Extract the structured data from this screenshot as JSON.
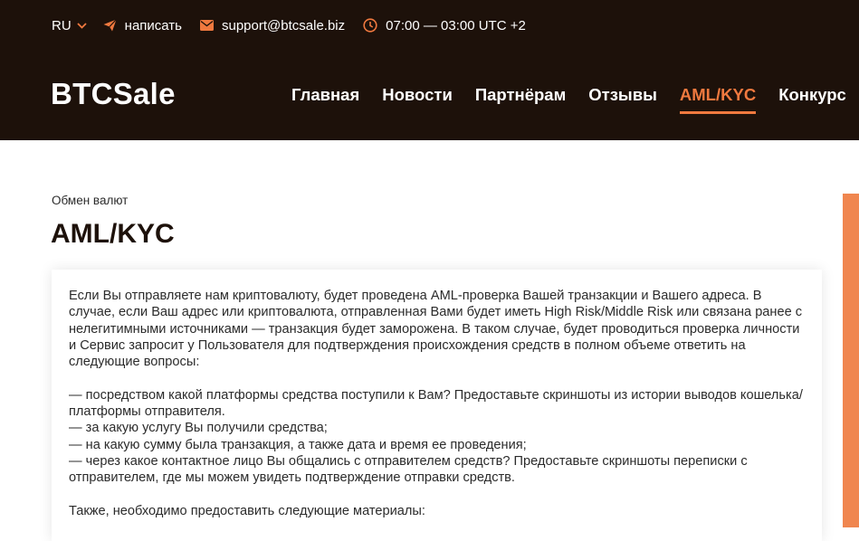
{
  "topbar": {
    "lang": "RU",
    "write_label": "написать",
    "email": "support@btcsale.biz",
    "hours": "07:00 — 03:00 UTC +2"
  },
  "header": {
    "logo": "BTCSale",
    "nav": [
      {
        "label": "Главная",
        "active": false
      },
      {
        "label": "Новости",
        "active": false
      },
      {
        "label": "Партнёрам",
        "active": false
      },
      {
        "label": "Отзывы",
        "active": false
      },
      {
        "label": "AML/KYC",
        "active": true
      },
      {
        "label": "Конкурс",
        "active": false
      }
    ]
  },
  "breadcrumb": "Обмен валют",
  "page_title": "AML/KYC",
  "content": {
    "intro": "Если Вы отправляете нам криптовалюту, будет проведена AML-проверка Вашей транзакции и Вашего адреса. В случае, если Ваш адрес или криптовалюта, отправленная Вами будет иметь High Risk/Middle Risk или связана ранее с нелегитимными источниками — транзакция будет заморожена. В таком случае, будет проводиться проверка личности и Сервис запросит у Пользователя для подтверждения происхождения средств в полном объеме ответить на следующие вопросы:",
    "questions": [
      "— посредством какой платформы средства поступили к Вам? Предоставьте скриншоты из истории выводов кошелька/платформы отправителя.",
      "— за какую услугу Вы получили средства;",
      "— на какую сумму была транзакция, а также дата и время ее проведения;",
      "— через какое контактное лицо Вы общались с отправителем средств? Предоставьте скриншоты переписки с отправителем, где мы можем увидеть подтверждение отправки средств."
    ],
    "materials": "Также, необходимо предоставить следующие материалы:"
  },
  "colors": {
    "header_bg": "#1d110a",
    "accent": "#f0793f"
  }
}
